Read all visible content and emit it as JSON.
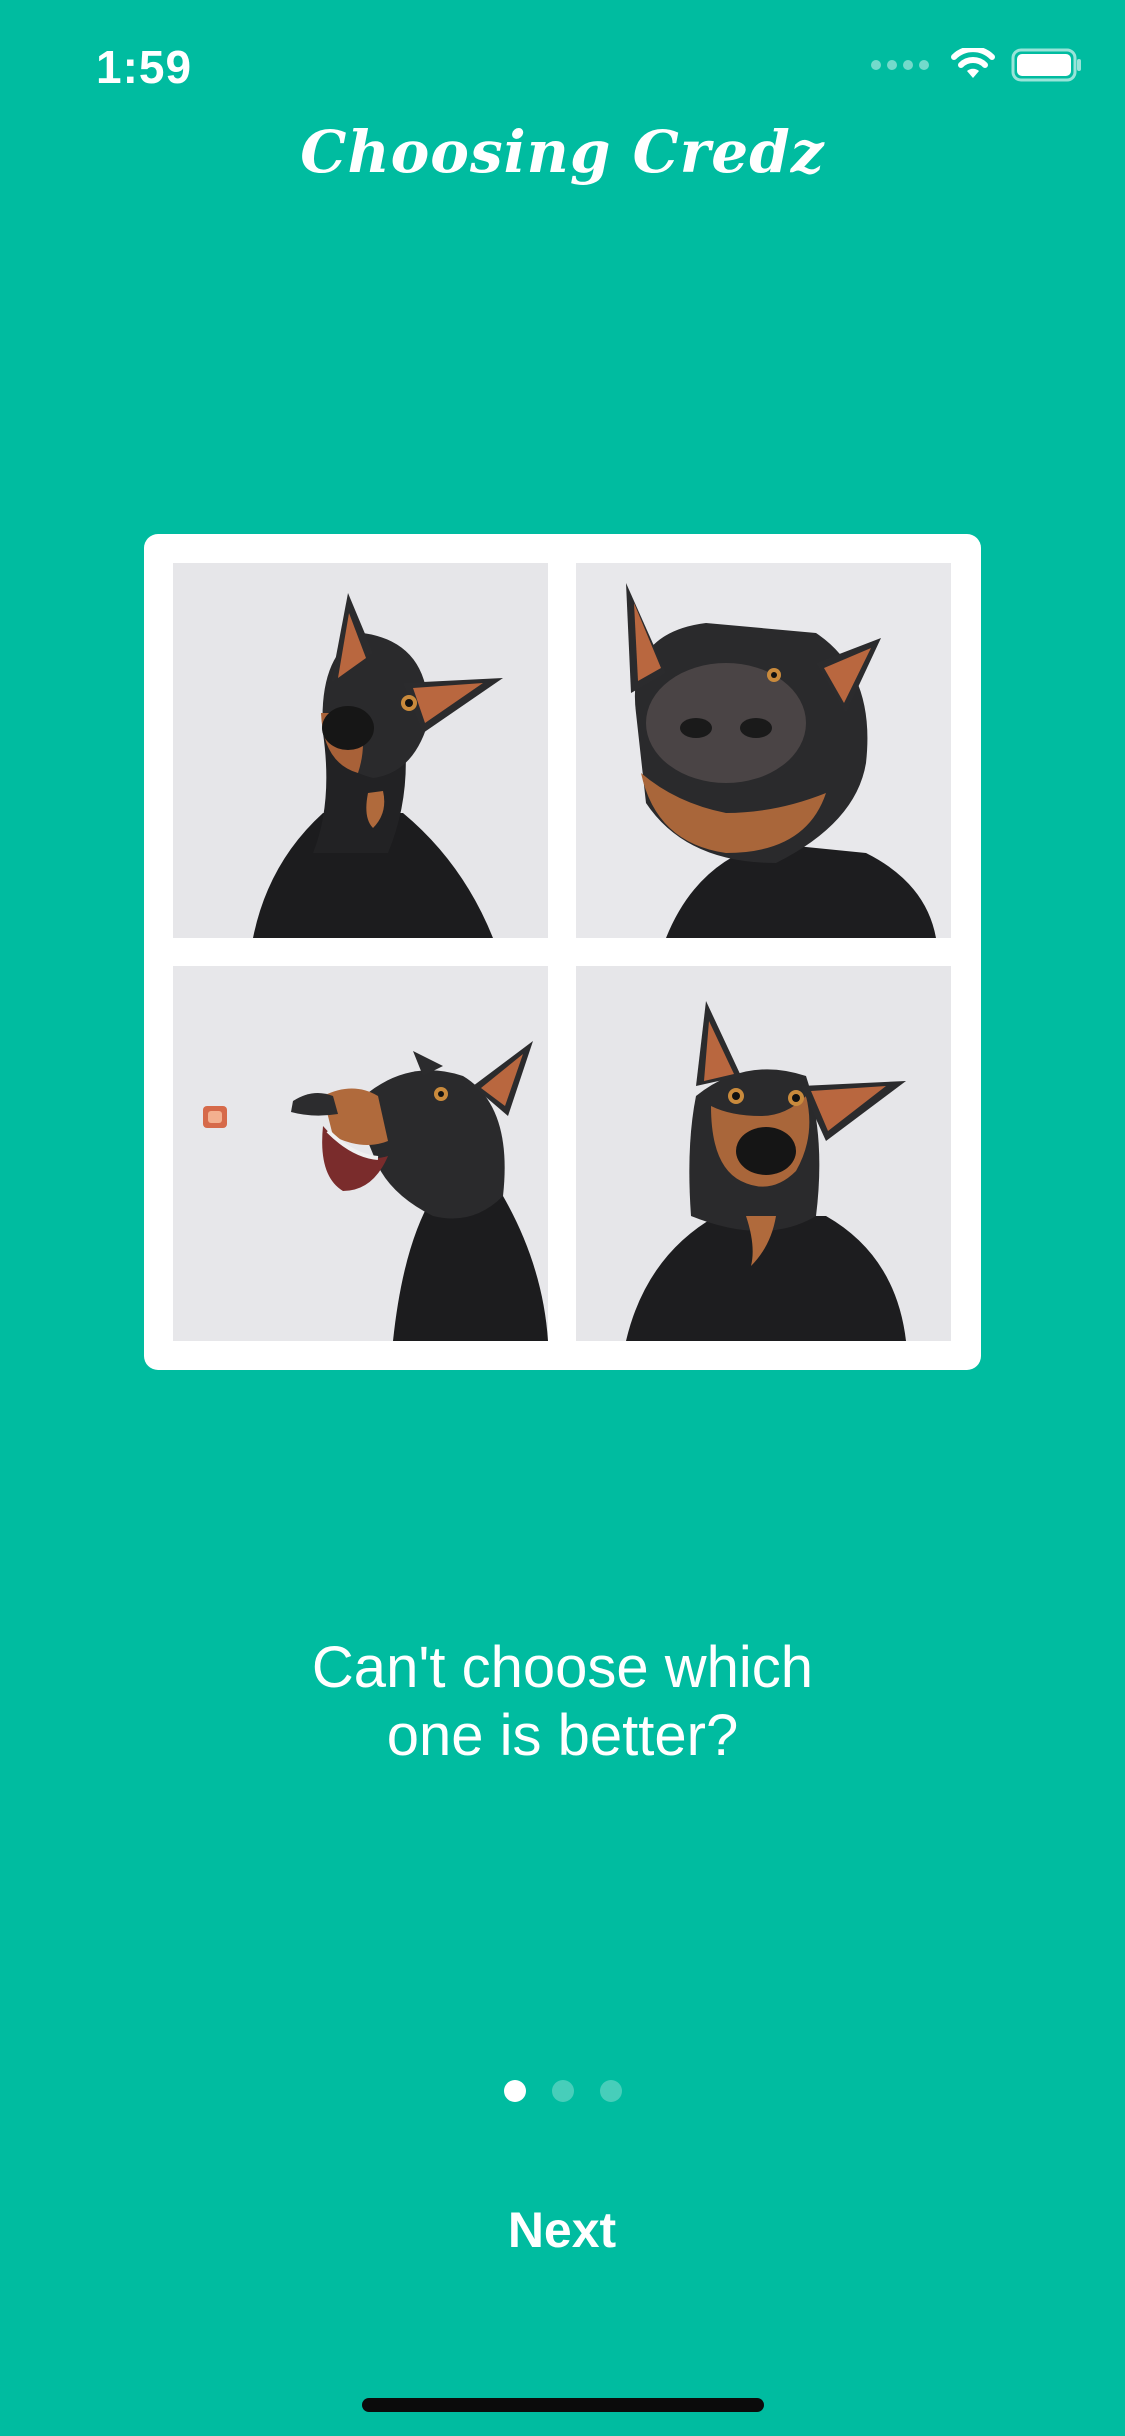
{
  "status_bar": {
    "time": "1:59",
    "icons": [
      "cellular-signal-icon",
      "wifi-icon",
      "battery-icon"
    ]
  },
  "header": {
    "title": "Choosing Credz"
  },
  "collage": {
    "photos": [
      {
        "subject": "doberman-head-tilt-photo"
      },
      {
        "subject": "doberman-close-nose-photo"
      },
      {
        "subject": "doberman-catching-treat-photo"
      },
      {
        "subject": "doberman-front-facing-photo"
      }
    ]
  },
  "message": {
    "line1": "Can't choose which",
    "line2": "one is better?"
  },
  "pager": {
    "total": 3,
    "current": 1
  },
  "actions": {
    "next_label": "Next"
  },
  "colors": {
    "background": "#00bca0",
    "text": "#ffffff",
    "card": "#ffffff",
    "photo_bg": "#e7e7ea"
  }
}
